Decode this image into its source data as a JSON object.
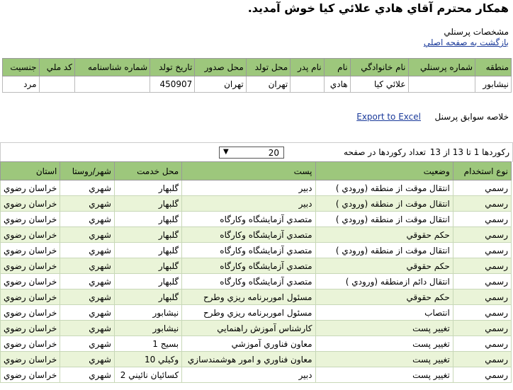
{
  "header": {
    "welcome": "همكار محترم آقاي هادي علائي كيا خوش آمديد.",
    "section_label": "مشخصات پرسنلي",
    "back_link": "بازگشت به صفحه اصلي"
  },
  "info_table": {
    "columns": [
      "منطقه",
      "شماره پرسنلي",
      "نام خانوادگي",
      "نام",
      "نام پدر",
      "محل تولد",
      "محل صدور",
      "تاريخ تولد",
      "شماره شناسنامه",
      "كد ملي",
      "جنسيت"
    ],
    "row": [
      "نيشابور",
      "",
      "علائي كيا",
      "هادي",
      "",
      "تهران",
      "تهران",
      "450907",
      "",
      "",
      "مرد"
    ]
  },
  "summary": {
    "label": "خلاصه سوابق پرسنل",
    "export": "Export to Excel"
  },
  "pager": {
    "records_text": "ركوردها 1 تا 13 از 13",
    "page_size_label": "تعداد ركوردها در صفحه",
    "page_size": "20"
  },
  "records_table": {
    "columns": [
      "نوع استخدام",
      "وضعيت",
      "پست",
      "محل خدمت",
      "شهر/روستا",
      "استان"
    ],
    "rows": [
      [
        "رسمي",
        "انتقال موقت از منطقه (ورودي )",
        "دبير",
        "گلبهار",
        "شهري",
        "خراسان رضوي"
      ],
      [
        "رسمي",
        "انتقال موقت از منطقه (ورودي )",
        "دبير",
        "گلبهار",
        "شهري",
        "خراسان رضوي"
      ],
      [
        "رسمي",
        "انتقال موقت از منطقه (ورودي )",
        "متصدي آزمايشگاه وكارگاه",
        "گلبهار",
        "شهري",
        "خراسان رضوي"
      ],
      [
        "رسمي",
        "حكم حقوقي",
        "متصدي آزمايشگاه وكارگاه",
        "گلبهار",
        "شهري",
        "خراسان رضوي"
      ],
      [
        "رسمي",
        "انتقال موقت از منطقه (ورودي )",
        "متصدي آزمايشگاه وكارگاه",
        "گلبهار",
        "شهري",
        "خراسان رضوي"
      ],
      [
        "رسمي",
        "حكم حقوقي",
        "متصدي آزمايشگاه وكارگاه",
        "گلبهار",
        "شهري",
        "خراسان رضوي"
      ],
      [
        "رسمي",
        "انتقال دائم ازمنطقه (ورودي )",
        "متصدي آزمايشگاه وكارگاه",
        "گلبهار",
        "شهري",
        "خراسان رضوي"
      ],
      [
        "رسمي",
        "حكم حقوقي",
        "مسئول اموربرنامه ريزي وطرح",
        "گلبهار",
        "شهري",
        "خراسان رضوي"
      ],
      [
        "رسمي",
        "انتصاب",
        "مسئول اموربرنامه ريزي وطرح",
        "نيشابور",
        "شهري",
        "خراسان رضوي"
      ],
      [
        "رسمي",
        "تغيير پست",
        "كارشناس آموزش راهنمايي",
        "نيشابور",
        "شهري",
        "خراسان رضوي"
      ],
      [
        "رسمي",
        "تغيير پست",
        "معاون فناوري آموزشي",
        "بسيج 1",
        "شهري",
        "خراسان رضوي"
      ],
      [
        "رسمي",
        "تغيير پست",
        "معاون فناوري و امور هوشمندسازي",
        "وكيلي 10",
        "شهري",
        "خراسان رضوي"
      ],
      [
        "رسمي",
        "تغيير پست",
        "دبير",
        "كسائيان نائيني 2",
        "شهري",
        "خراسان رضوي"
      ]
    ]
  }
}
